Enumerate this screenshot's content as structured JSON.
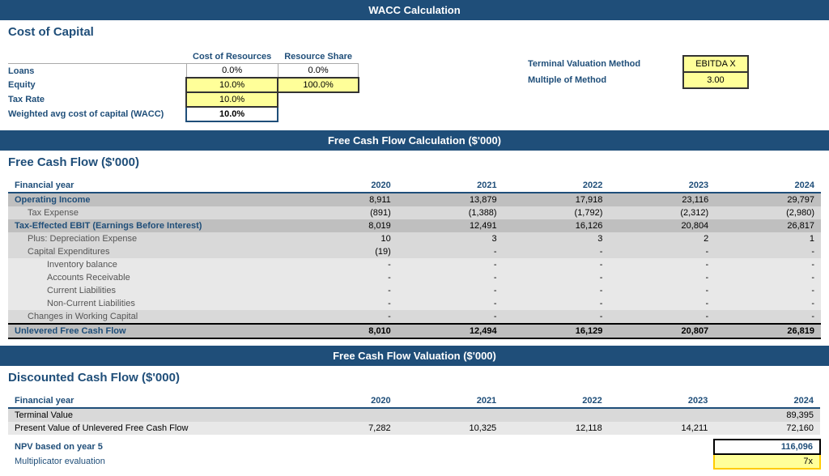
{
  "wacc_header": "WACC Calculation",
  "cost_of_capital_title": "Cost of Capital",
  "wacc_col1": "Cost of Resources",
  "wacc_col2": "Resource Share",
  "loans_label": "Loans",
  "loans_cost": "0.0%",
  "loans_share": "0.0%",
  "equity_label": "Equity",
  "equity_cost": "10.0%",
  "equity_share": "100.0%",
  "tax_rate_label": "Tax Rate",
  "tax_rate_value": "10.0%",
  "wacc_label": "Weighted avg cost of capital (WACC)",
  "wacc_value": "10.0%",
  "terminal_valuation_label": "Terminal Valuation Method",
  "terminal_valuation_value": "EBITDA X",
  "multiple_of_method_label": "Multiple of Method",
  "multiple_of_method_value": "3.00",
  "fcf_header": "Free Cash Flow Calculation ($'000)",
  "fcf_title": "Free Cash Flow ($'000)",
  "financial_year_label": "Financial year",
  "years": [
    "2020",
    "2021",
    "2022",
    "2023",
    "2024"
  ],
  "operating_income_label": "Operating Income",
  "operating_income": [
    "8,911",
    "13,879",
    "17,918",
    "23,116",
    "29,797"
  ],
  "tax_expense_label": "Tax Expense",
  "tax_expense": [
    "(891)",
    "(1,388)",
    "(1,792)",
    "(2,312)",
    "(2,980)"
  ],
  "tax_effected_label": "Tax-Effected EBIT (Earnings Before Interest)",
  "tax_effected": [
    "8,019",
    "12,491",
    "16,126",
    "20,804",
    "26,817"
  ],
  "depreciation_label": "Plus: Depreciation Expense",
  "depreciation": [
    "10",
    "3",
    "3",
    "2",
    "1"
  ],
  "capex_label": "Capital Expenditures",
  "capex": [
    "(19)",
    "-",
    "-",
    "-",
    "-"
  ],
  "inventory_label": "Inventory balance",
  "inventory": [
    "-",
    "-",
    "-",
    "-",
    "-"
  ],
  "accounts_receivable_label": "Accounts Receivable",
  "accounts_receivable": [
    "-",
    "-",
    "-",
    "-",
    "-"
  ],
  "current_liabilities_label": "Current Liabilities",
  "current_liabilities": [
    "-",
    "-",
    "-",
    "-",
    "-"
  ],
  "non_current_label": "Non-Current Liabilities",
  "non_current": [
    "-",
    "-",
    "-",
    "-",
    "-"
  ],
  "changes_wc_label": "Changes in Working Capital",
  "changes_wc": [
    "-",
    "-",
    "-",
    "-",
    "-"
  ],
  "ufcf_label": "Unlevered Free Cash Flow",
  "ufcf": [
    "8,010",
    "12,494",
    "16,129",
    "20,807",
    "26,819"
  ],
  "fcf_valuation_header": "Free Cash Flow Valuation ($'000)",
  "dcf_title": "Discounted Cash Flow ($'000)",
  "dcf_fin_year": "Financial year",
  "dcf_years": [
    "2020",
    "2021",
    "2022",
    "2023",
    "2024"
  ],
  "terminal_value_label": "Terminal Value",
  "terminal_value": [
    "",
    "",
    "",
    "",
    "89,395"
  ],
  "pv_ufcf_label": "Present Value of Unlevered Free Cash Flow",
  "pv_ufcf": [
    "7,282",
    "10,325",
    "12,118",
    "14,211",
    "72,160"
  ],
  "npv_label": "NPV based on year 5",
  "npv_value": "116,096",
  "multiplicator_label": "Multiplicator evaluation",
  "multiplicator_value": "7x"
}
